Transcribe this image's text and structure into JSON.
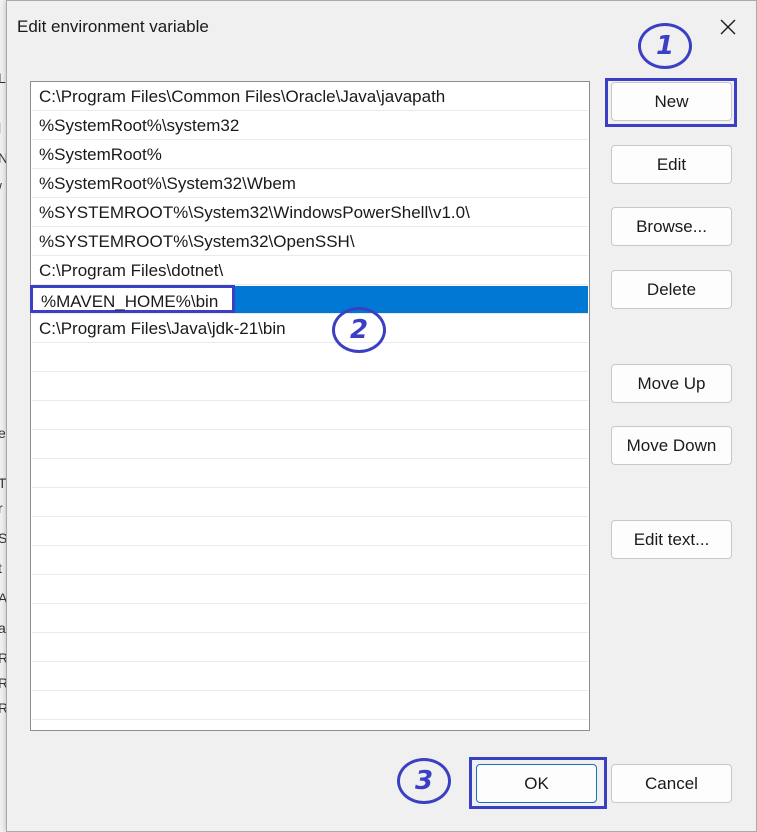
{
  "dialog": {
    "title": "Edit environment variable",
    "close_icon": "close-icon"
  },
  "path_entries": [
    "C:\\Program Files\\Common Files\\Oracle\\Java\\javapath",
    "%SystemRoot%\\system32",
    "%SystemRoot%",
    "%SystemRoot%\\System32\\Wbem",
    "%SYSTEMROOT%\\System32\\WindowsPowerShell\\v1.0\\",
    "%SYSTEMROOT%\\System32\\OpenSSH\\",
    "C:\\Program Files\\dotnet\\",
    "%MAVEN_HOME%\\bin",
    "C:\\Program Files\\Java\\jdk-21\\bin"
  ],
  "selected_index": 7,
  "buttons": {
    "new": "New",
    "edit": "Edit",
    "browse": "Browse...",
    "delete": "Delete",
    "move_up": "Move Up",
    "move_down": "Move Down",
    "edit_text": "Edit text...",
    "ok": "OK",
    "cancel": "Cancel"
  },
  "annotations": {
    "step1": "1",
    "step2": "2",
    "step3": "3"
  },
  "colors": {
    "selection": "#0078d4",
    "annotation": "#3b3fc4"
  }
}
